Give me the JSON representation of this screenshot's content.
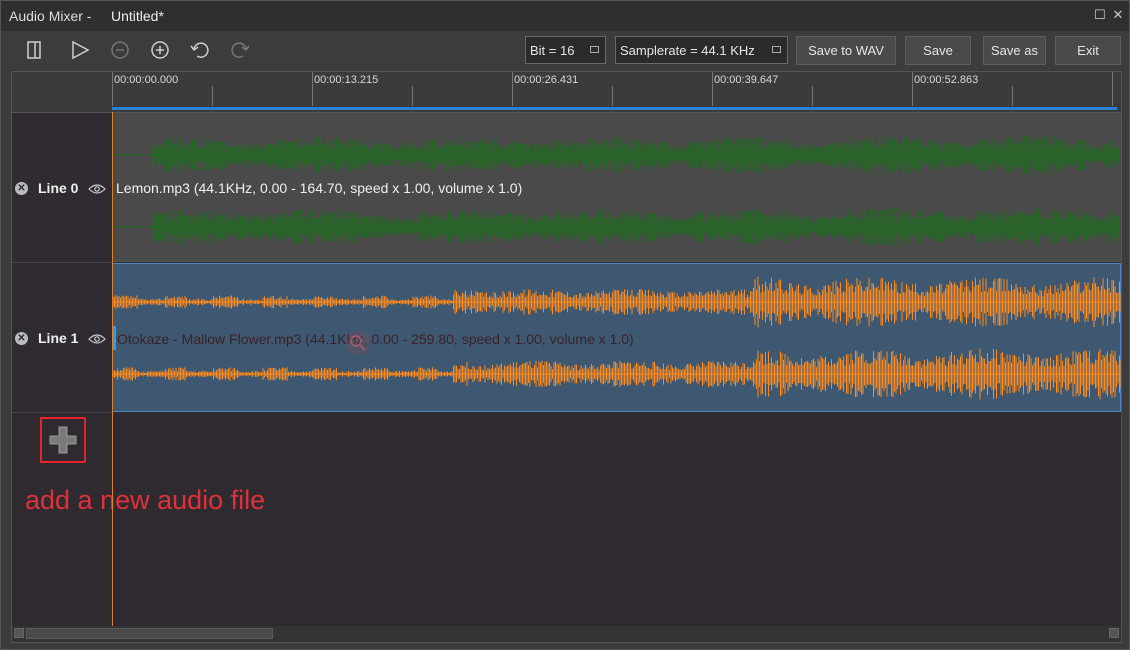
{
  "window": {
    "app_title": "Audio Mixer -",
    "doc_title": "Untitled*",
    "maximize_glyph": "☐",
    "close_glyph": "✕"
  },
  "toolbar": {
    "icons": [
      "panel-icon",
      "play-icon",
      "zoom-out-icon",
      "zoom-in-icon",
      "undo-icon",
      "redo-icon"
    ],
    "bit_select": "Bit = 16",
    "samplerate_select": "Samplerate = 44.1 KHz",
    "save_wav": "Save to WAV",
    "save": "Save",
    "save_as": "Save as",
    "exit": "Exit"
  },
  "ruler": {
    "labels": [
      "00:00:00.000",
      "00:00:13.215",
      "00:00:26.431",
      "00:00:39.647",
      "00:00:52.863"
    ]
  },
  "tracks": [
    {
      "name": "Line 0",
      "clip": "Lemon.mp3  (44.1KHz, 0.00 - 164.70, speed x 1.00, volume x 1.0)",
      "wave_color": "#1e6e1e",
      "bg_color": "#4a4a4a",
      "selected": false
    },
    {
      "name": "Line 1",
      "clip": "Otokaze - Mallow Flower.mp3  (44.1KHz, 0.00 - 259.80, speed x 1.00, volume x 1.0)",
      "wave_color": "#ff8a1a",
      "bg_color": "#3f5872",
      "selected": true
    }
  ],
  "annotation": {
    "text": "add a new audio file",
    "color": "#e0313a"
  },
  "colors": {
    "playhead": "#e0802b",
    "ruler_bar": "#2d7fd6"
  }
}
